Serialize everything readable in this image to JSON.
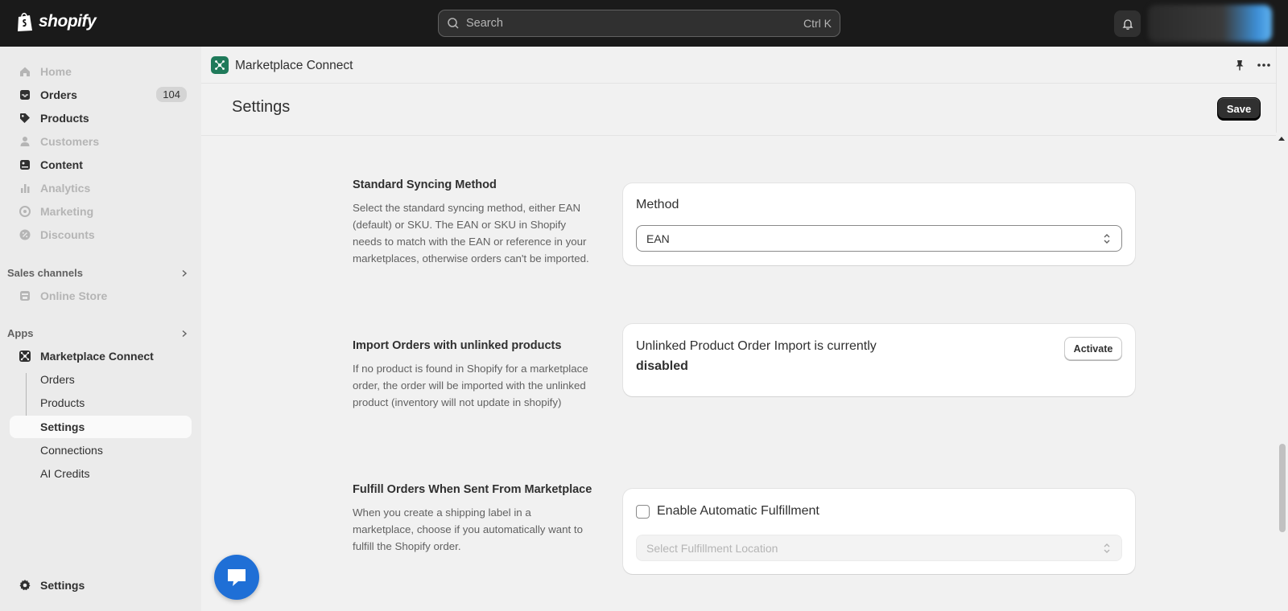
{
  "topbar": {
    "brand": "shopify",
    "search_placeholder": "Search",
    "search_shortcut": "Ctrl K"
  },
  "sidebar": {
    "items": [
      {
        "label": "Home",
        "icon": "home-icon",
        "enabled": false
      },
      {
        "label": "Orders",
        "icon": "inbox-icon",
        "enabled": true,
        "badge": "104"
      },
      {
        "label": "Products",
        "icon": "tag-icon",
        "enabled": true
      },
      {
        "label": "Customers",
        "icon": "person-icon",
        "enabled": false
      },
      {
        "label": "Content",
        "icon": "content-icon",
        "enabled": true
      },
      {
        "label": "Analytics",
        "icon": "bar-chart-icon",
        "enabled": false
      },
      {
        "label": "Marketing",
        "icon": "target-icon",
        "enabled": false
      },
      {
        "label": "Discounts",
        "icon": "discount-icon",
        "enabled": false
      }
    ],
    "sales_channels": {
      "title": "Sales channels",
      "items": [
        {
          "label": "Online Store",
          "icon": "store-icon",
          "enabled": false
        }
      ]
    },
    "apps": {
      "title": "Apps",
      "app_name": "Marketplace Connect",
      "sub_items": [
        {
          "label": "Orders",
          "active": false
        },
        {
          "label": "Products",
          "active": false
        },
        {
          "label": "Settings",
          "active": true
        },
        {
          "label": "Connections",
          "active": false
        },
        {
          "label": "AI Credits",
          "active": false
        }
      ]
    },
    "footer_settings": "Settings"
  },
  "app_header": {
    "title": "Marketplace Connect"
  },
  "page": {
    "title": "Settings",
    "save_label": "Save",
    "sections": [
      {
        "title": "Standard Syncing Method",
        "description": "Select the standard syncing method, either EAN (default) or SKU. The EAN or SKU in Shopify needs to match with the EAN or reference in your marketplaces, otherwise orders can't be imported.",
        "card_label": "Method",
        "select_value": "EAN"
      },
      {
        "title": "Import Orders with unlinked products",
        "description": "If no product is found in Shopify for a marketplace order, the order will be imported with the unlinked product (inventory will not update in shopify)",
        "status_text": "Unlinked Product Order Import is currently",
        "status_value": "disabled",
        "button_label": "Activate"
      },
      {
        "title": "Fulfill Orders When Sent From Marketplace",
        "description": "When you create a shipping label in a marketplace, choose if you automatically want to fulfill the Shopify order.",
        "checkbox_label": "Enable Automatic Fulfillment",
        "checkbox_checked": false,
        "select_placeholder": "Select Fulfillment Location"
      }
    ]
  },
  "colors": {
    "topbar": "#1a1a1a",
    "sidebar": "#ebebeb",
    "app_logo": "#1f7a5a",
    "chat": "#1f6fd6"
  }
}
